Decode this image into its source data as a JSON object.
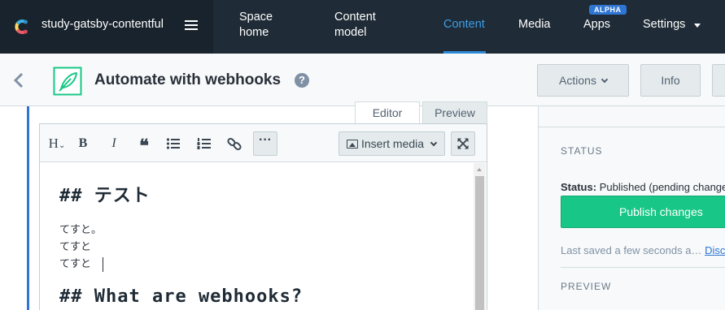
{
  "topnav": {
    "space_name": "study-gatsby-contentful",
    "items": [
      {
        "label": "Space\nhome"
      },
      {
        "label": "Content\nmodel"
      },
      {
        "label": "Content",
        "active": true
      },
      {
        "label": "Media"
      },
      {
        "label": "Apps",
        "badge": "ALPHA"
      },
      {
        "label": "Settings"
      }
    ]
  },
  "entry": {
    "title": "Automate with webhooks",
    "help": "?",
    "actions_label": "Actions",
    "info_label": "Info"
  },
  "editor": {
    "tabs": [
      {
        "label": "Editor",
        "active": true
      },
      {
        "label": "Preview"
      }
    ],
    "toolbar": {
      "heading": "H",
      "bold": "B",
      "italic": "I",
      "quote": "❝",
      "more": "···",
      "insert_media": "Insert media"
    },
    "content": {
      "heading1": "## テスト",
      "lines": [
        "てすと。",
        "てすと",
        "てすと"
      ],
      "heading2": "## What are webhooks?"
    }
  },
  "sidebar": {
    "status_heading": "STATUS",
    "status_label": "Status:",
    "status_value": "Published (pending changes)",
    "publish_label": "Publish changes",
    "last_saved_text": "Last saved a few seconds a…",
    "discard_link": "Discard",
    "preview_heading": "PREVIEW"
  },
  "colors": {
    "nav_bg": "#1f2b36",
    "accent": "#2e75d4",
    "publish_green": "#18c787"
  }
}
